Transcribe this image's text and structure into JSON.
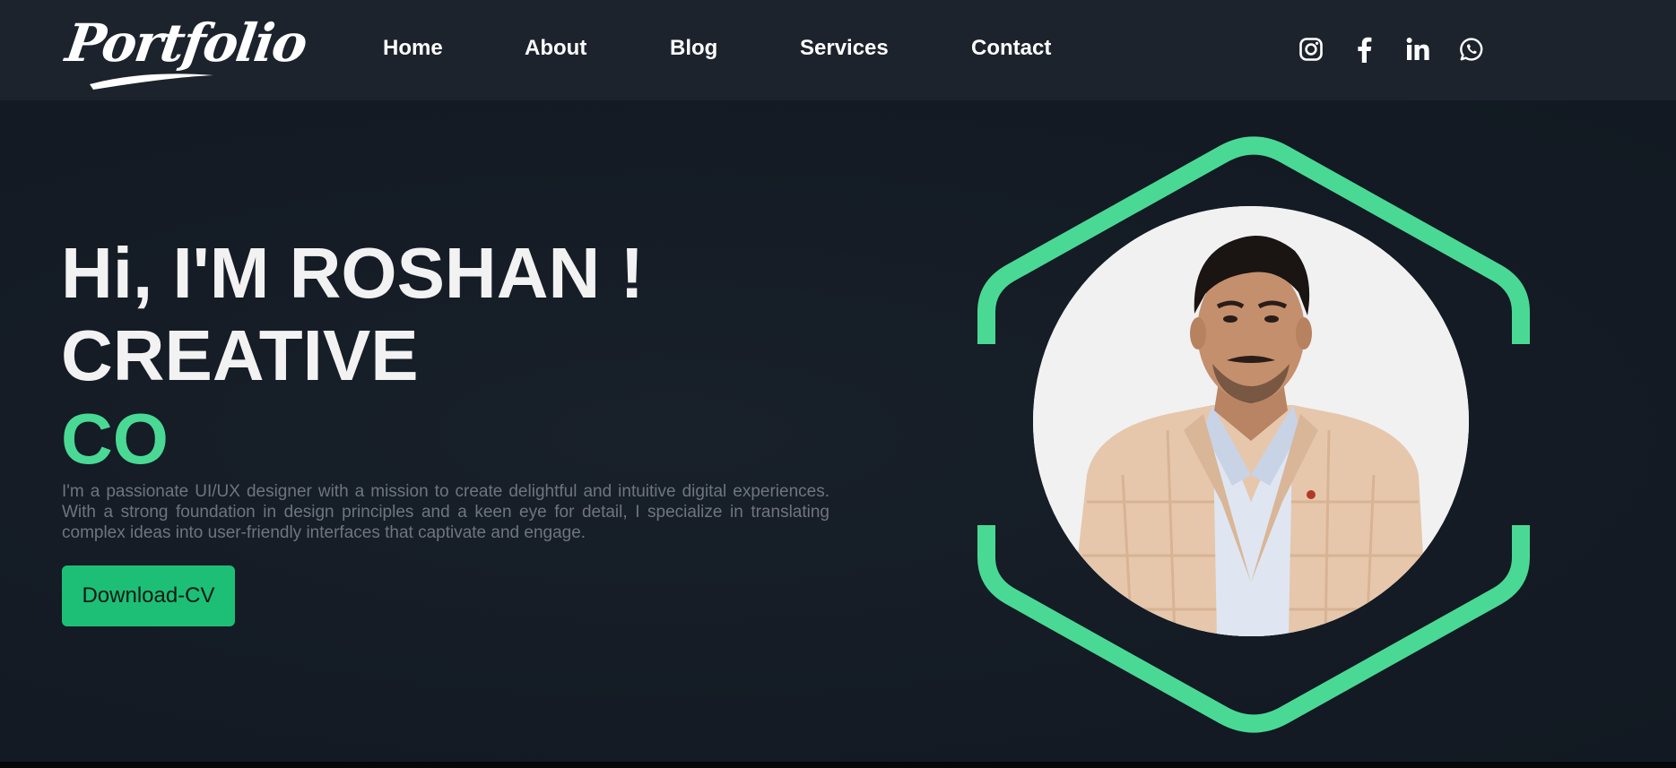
{
  "brand": {
    "logo_text": "Portfolio"
  },
  "nav": {
    "links": [
      "Home",
      "About",
      "Blog",
      "Services",
      "Contact"
    ]
  },
  "social": {
    "icons": [
      "instagram-icon",
      "facebook-icon",
      "linkedin-icon",
      "whatsapp-icon"
    ]
  },
  "hero": {
    "greeting": "Hi, I'M ROSHAN !",
    "line2": "CREATIVE",
    "line3": "CO",
    "description": "I'm a passionate UI/UX designer with a mission to create delightful and intuitive digital experiences. With a strong foundation in design principles and a keen eye for detail, I specialize in translating complex ideas into user-friendly interfaces that captivate and engage.",
    "cv_button": "Download-CV"
  },
  "colors": {
    "accent": "#4ad994",
    "button": "#1dbf77",
    "nav_bg": "#1d232c",
    "hero_bg": "#141b24"
  }
}
